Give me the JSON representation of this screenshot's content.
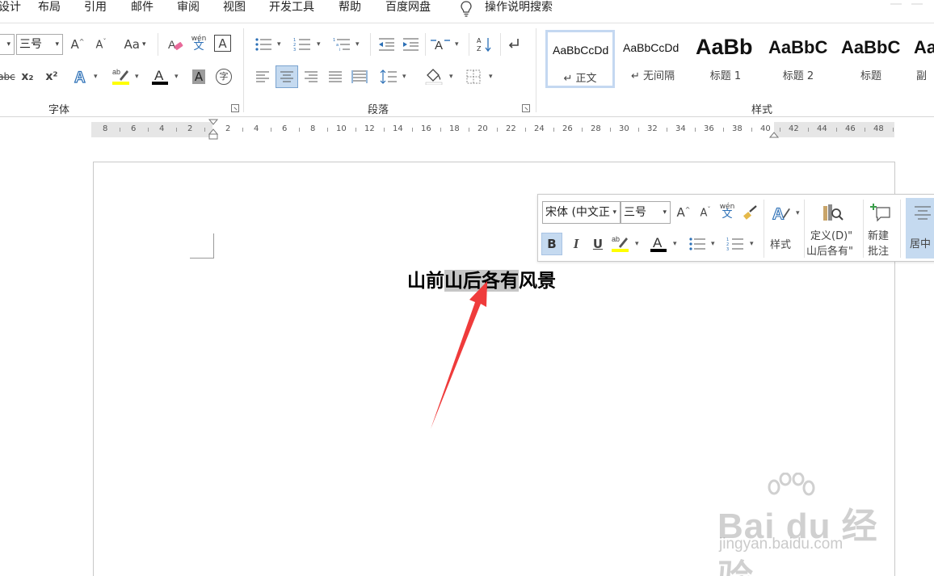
{
  "menu": {
    "items": [
      "设计",
      "布局",
      "引用",
      "邮件",
      "审阅",
      "视图",
      "开发工具",
      "帮助",
      "百度网盘"
    ],
    "tell_me": "操作说明搜索"
  },
  "ribbon": {
    "font_group": {
      "label": "字体",
      "font_size": "三号",
      "change_case": "Aa",
      "phonetic": "wén",
      "phonetic_char": "文",
      "char_border": "A",
      "subscript": "x₂",
      "superscript": "x²",
      "enclose": "字"
    },
    "paragraph_group": {
      "label": "段落"
    },
    "styles_group": {
      "label": "样式",
      "tiles": [
        {
          "preview": "AaBbCcDd",
          "name": "↵ 正文"
        },
        {
          "preview": "AaBbCcDd",
          "name": "↵ 无间隔"
        },
        {
          "preview": "AaBb",
          "name": "标题 1"
        },
        {
          "preview": "AaBbC",
          "name": "标题 2"
        },
        {
          "preview": "AaBbC",
          "name": "标题"
        },
        {
          "preview": "Aa",
          "name": "副"
        }
      ]
    }
  },
  "ruler": {
    "numbers": [
      "8",
      "6",
      "4",
      "2",
      "2",
      "4",
      "6",
      "8",
      "10",
      "12",
      "14",
      "16",
      "18",
      "20",
      "22",
      "24",
      "26",
      "28",
      "30",
      "32",
      "34",
      "36",
      "38",
      "40",
      "42",
      "44",
      "46",
      "48"
    ]
  },
  "document": {
    "title_before": "山前",
    "title_selected": "山后各有",
    "title_after": "风景"
  },
  "mini_toolbar": {
    "font_name": "宋体 (中文正",
    "font_size": "三号",
    "bold": "B",
    "italic": "I",
    "underline": "U",
    "phonetic": "wén",
    "phonetic_char": "文",
    "styles_label": "样式",
    "define_line1": "定义(D)\"",
    "define_line2": "山后各有\"",
    "new_comment_line1": "新建",
    "new_comment_line2": "批注",
    "center_label": "居中"
  },
  "watermark": {
    "brand": "Bai du 经验",
    "url": "jingyan.baidu.com"
  },
  "colors": {
    "highlight_yellow": "#ffff00",
    "font_color_red": "#d40000",
    "arrow_red": "#ef3b3b",
    "selection_grey": "#c6c6c6",
    "ribbon_selected": "#c5daf0"
  }
}
